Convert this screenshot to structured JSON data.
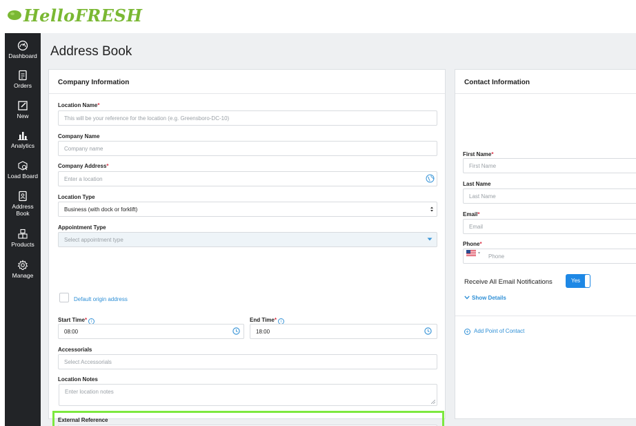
{
  "brand": {
    "name": "HelloFRESH"
  },
  "sidebar": {
    "items": [
      {
        "label": "Dashboard",
        "icon": "dashboard-gauge-icon"
      },
      {
        "label": "Orders",
        "icon": "orders-document-icon"
      },
      {
        "label": "New",
        "icon": "new-edit-icon"
      },
      {
        "label": "Analytics",
        "icon": "analytics-bars-icon"
      },
      {
        "label": "Load Board",
        "icon": "load-board-search-icon"
      },
      {
        "label": "Address Book",
        "icon": "address-book-icon"
      },
      {
        "label": "Products",
        "icon": "products-boxes-icon"
      },
      {
        "label": "Manage",
        "icon": "manage-gear-icon"
      }
    ]
  },
  "page": {
    "title": "Address Book"
  },
  "company": {
    "title": "Company Information",
    "location_name": {
      "label": "Location Name",
      "placeholder": "This will be your reference for the location (e.g. Greensboro-DC-10)"
    },
    "company_name": {
      "label": "Company Name",
      "placeholder": "Company name"
    },
    "company_address": {
      "label": "Company Address",
      "placeholder": "Enter a location"
    },
    "location_type": {
      "label": "Location Type",
      "value": "Business (with dock or forklift)"
    },
    "appointment_type": {
      "label": "Appointment Type",
      "placeholder": "Select appointment type"
    },
    "default_origin": {
      "label": "Default origin address",
      "checked": false
    },
    "start_time": {
      "label": "Start Time",
      "value": "08:00"
    },
    "end_time": {
      "label": "End Time",
      "value": "18:00"
    },
    "accessorials": {
      "label": "Accessorials",
      "placeholder": "Select Accessorials"
    },
    "location_notes": {
      "label": "Location Notes",
      "placeholder": "Enter location notes"
    },
    "external_reference": {
      "label": "External Reference",
      "value": ""
    }
  },
  "contact": {
    "title": "Contact Information",
    "first_name": {
      "label": "First Name",
      "placeholder": "First Name"
    },
    "last_name": {
      "label": "Last Name",
      "placeholder": "Last Name"
    },
    "email": {
      "label": "Email",
      "placeholder": "Email"
    },
    "phone": {
      "label": "Phone",
      "placeholder": "Phone"
    },
    "notifications": {
      "label": "Receive All Email Notifications",
      "toggle_label": "Yes"
    },
    "show_details": "Show Details",
    "add_poc": "Add Point of Contact"
  },
  "colors": {
    "brand_green": "#7ab833",
    "accent_blue": "#1e88e5",
    "link_blue": "#2e8fd6",
    "required_red": "#d9364a",
    "highlight_green": "#7de83f",
    "sidebar_bg": "#222427"
  }
}
